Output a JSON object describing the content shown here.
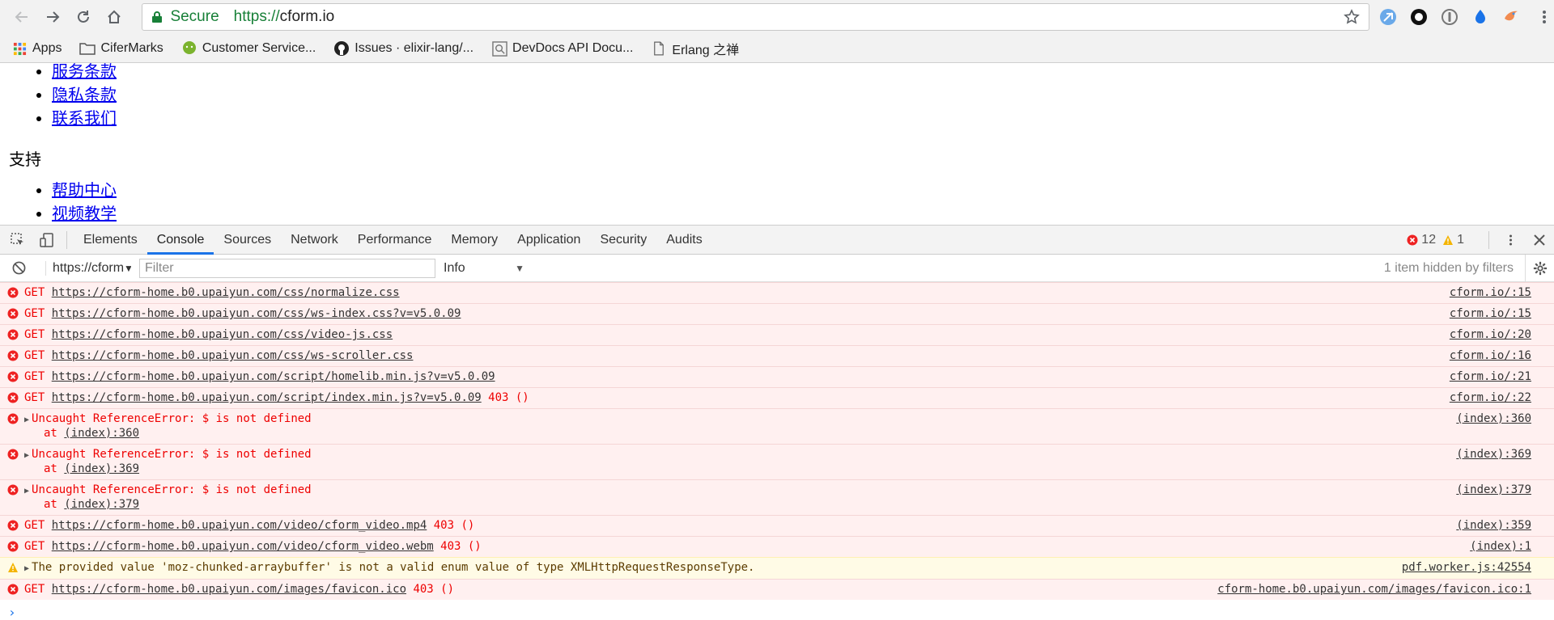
{
  "browser": {
    "secure_label": "Secure",
    "url_protocol": "https://",
    "url_host": "cform.io",
    "bookmarks": [
      {
        "label": "Apps",
        "icon": "apps-grid-icon"
      },
      {
        "label": "CiferMarks",
        "icon": "folder-icon"
      },
      {
        "label": "Customer Service...",
        "icon": "wechat-icon"
      },
      {
        "label": "Issues · elixir-lang/...",
        "icon": "github-icon"
      },
      {
        "label": "DevDocs API Docu...",
        "icon": "devdocs-icon"
      },
      {
        "label": "Erlang 之禅",
        "icon": "page-icon"
      }
    ],
    "colors": {
      "secure": "#188038",
      "accent": "#1a73e8"
    }
  },
  "page": {
    "list1": [
      "服务条款",
      "隐私条款",
      "联系我们"
    ],
    "heading": "支持",
    "list2": [
      "帮助中心",
      "视频教学"
    ]
  },
  "devtools": {
    "tabs": [
      "Elements",
      "Console",
      "Sources",
      "Network",
      "Performance",
      "Memory",
      "Application",
      "Security",
      "Audits"
    ],
    "active_tab": "Console",
    "error_count": "12",
    "warning_count": "1",
    "context": "https://cform",
    "filter_placeholder": "Filter",
    "level": "Info",
    "hidden_message": "1 item hidden by filters",
    "messages": [
      {
        "type": "error",
        "prefix": "GET ",
        "url": "https://cform-home.b0.upaiyun.com/css/normalize.css",
        "status": "",
        "source": "cform.io/:15"
      },
      {
        "type": "error",
        "prefix": "GET ",
        "url": "https://cform-home.b0.upaiyun.com/css/ws-index.css?v=v5.0.09",
        "status": "",
        "source": "cform.io/:15"
      },
      {
        "type": "error",
        "prefix": "GET ",
        "url": "https://cform-home.b0.upaiyun.com/css/video-js.css",
        "status": "",
        "source": "cform.io/:20"
      },
      {
        "type": "error",
        "prefix": "GET ",
        "url": "https://cform-home.b0.upaiyun.com/css/ws-scroller.css",
        "status": "",
        "source": "cform.io/:16"
      },
      {
        "type": "error",
        "prefix": "GET ",
        "url": "https://cform-home.b0.upaiyun.com/script/homelib.min.js?v=v5.0.09",
        "status": "",
        "source": "cform.io/:21"
      },
      {
        "type": "error",
        "prefix": "GET ",
        "url": "https://cform-home.b0.upaiyun.com/script/index.min.js?v=v5.0.09",
        "status": " 403 ()",
        "source": "cform.io/:22"
      },
      {
        "type": "error",
        "expandable": true,
        "text": "Uncaught ReferenceError: $ is not defined",
        "stack_prefix": "at ",
        "stack_link": "(index):360",
        "source": "(index):360"
      },
      {
        "type": "error",
        "expandable": true,
        "text": "Uncaught ReferenceError: $ is not defined",
        "stack_prefix": "at ",
        "stack_link": "(index):369",
        "source": "(index):369"
      },
      {
        "type": "error",
        "expandable": true,
        "text": "Uncaught ReferenceError: $ is not defined",
        "stack_prefix": "at ",
        "stack_link": "(index):379",
        "source": "(index):379"
      },
      {
        "type": "error",
        "prefix": "GET ",
        "url": "https://cform-home.b0.upaiyun.com/video/cform_video.mp4",
        "status": " 403 ()",
        "source": "(index):359"
      },
      {
        "type": "error",
        "prefix": "GET ",
        "url": "https://cform-home.b0.upaiyun.com/video/cform_video.webm",
        "status": " 403 ()",
        "source": "(index):1"
      },
      {
        "type": "warn",
        "expandable": true,
        "text": "The provided value 'moz-chunked-arraybuffer' is not a valid enum value of type XMLHttpRequestResponseType.",
        "source": "pdf.worker.js:42554"
      },
      {
        "type": "error",
        "prefix": "GET ",
        "url": "https://cform-home.b0.upaiyun.com/images/favicon.ico",
        "status": " 403 ()",
        "source": "cform-home.b0.upaiyun.com/images/favicon.ico:1"
      }
    ],
    "prompt_symbol": "›"
  }
}
